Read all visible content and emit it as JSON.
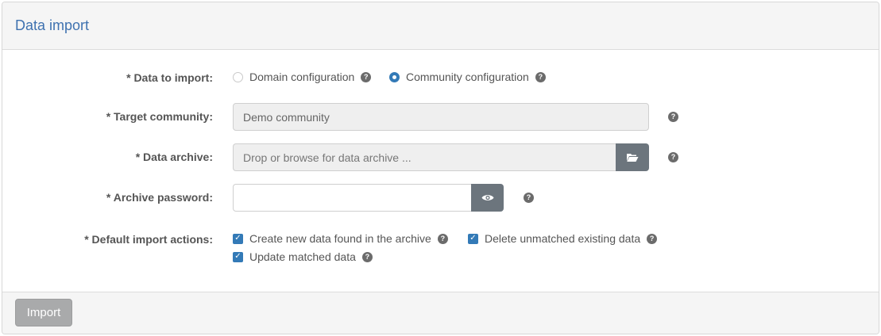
{
  "panel": {
    "title": "Data import"
  },
  "form": {
    "data_to_import": {
      "label": "* Data to import:",
      "options": [
        {
          "label": "Domain configuration",
          "checked": false
        },
        {
          "label": "Community configuration",
          "checked": true
        }
      ]
    },
    "target_community": {
      "label": "* Target community:",
      "value": "Demo community"
    },
    "data_archive": {
      "label": "* Data archive:",
      "placeholder": "Drop or browse for data archive ..."
    },
    "archive_password": {
      "label": "* Archive password:",
      "value": ""
    },
    "default_import_actions": {
      "label": "* Default import actions:",
      "options": [
        {
          "label": "Create new data found in the archive",
          "checked": true
        },
        {
          "label": "Delete unmatched existing data",
          "checked": true
        },
        {
          "label": "Update matched data",
          "checked": true
        }
      ]
    }
  },
  "help_glyph": "?",
  "footer": {
    "import_label": "Import"
  },
  "colors": {
    "accent": "#337ab7",
    "title": "#3f72b0",
    "button_disabled": "#a9aaab",
    "addon": "#6c757d"
  }
}
